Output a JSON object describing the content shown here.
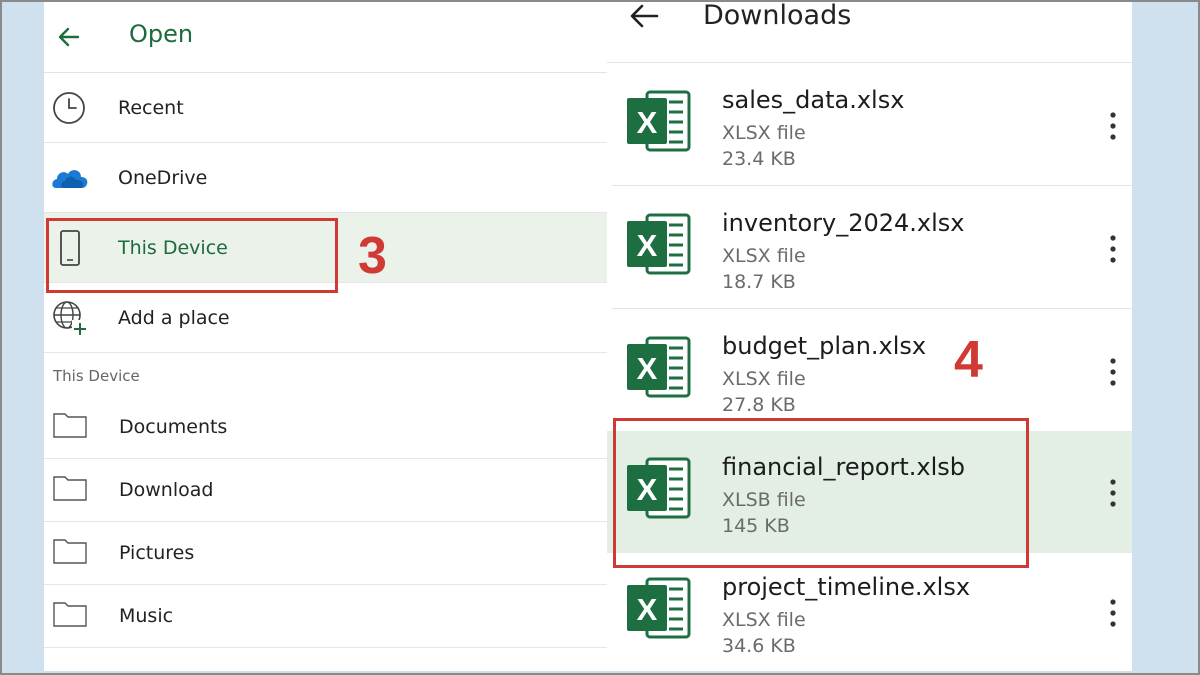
{
  "left": {
    "title": "Open",
    "nav": [
      {
        "label": "Recent",
        "icon": "clock-icon"
      },
      {
        "label": "OneDrive",
        "icon": "onedrive-cloud-icon"
      },
      {
        "label": "This Device",
        "icon": "phone-icon",
        "selected": true
      },
      {
        "label": "Add a place",
        "icon": "globe-add-icon"
      }
    ],
    "section_label": "This Device",
    "folders": [
      {
        "label": "Documents",
        "icon": "folder-icon"
      },
      {
        "label": "Download",
        "icon": "folder-icon"
      },
      {
        "label": "Pictures",
        "icon": "folder-icon"
      },
      {
        "label": "Music",
        "icon": "folder-icon"
      }
    ],
    "step_label": "3"
  },
  "right": {
    "title": "Downloads",
    "files": [
      {
        "name": "sales_data.xlsx",
        "type": "XLSX file",
        "size": "23.4 KB"
      },
      {
        "name": "inventory_2024.xlsx",
        "type": "XLSX file",
        "size": "18.7 KB"
      },
      {
        "name": "budget_plan.xlsx",
        "type": "XLSX file",
        "size": "27.8 KB"
      },
      {
        "name": "financial_report.xlsb",
        "type": "XLSB file",
        "size": "145 KB",
        "highlighted": true
      },
      {
        "name": "project_timeline.xlsx",
        "type": "XLSX file",
        "size": "34.6 KB"
      }
    ],
    "step_label": "4"
  },
  "colors": {
    "accent_green": "#1e6b3c",
    "excel_green": "#1d6f42",
    "callout_red": "#cf3a35",
    "selected_bg": "#eaf2ea",
    "highlight_bg": "#e3efe4",
    "backdrop": "#cfe0ee"
  }
}
